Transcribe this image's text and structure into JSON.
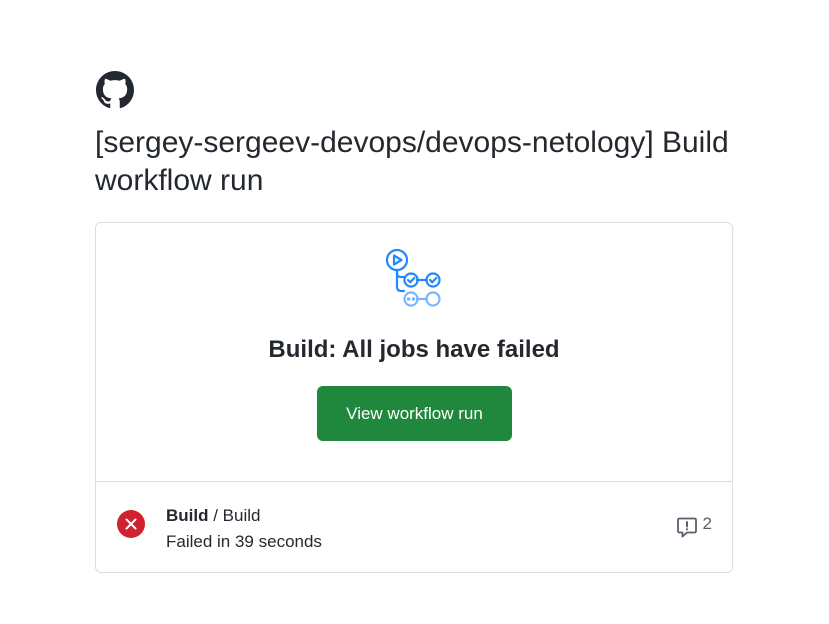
{
  "header": {
    "logo_icon": "github-mark-icon",
    "title": "[sergey-sergeev-devops/devops-netology] Build workflow run"
  },
  "card": {
    "icon": "workflow-icon",
    "headline": "Build: All jobs have failed",
    "button_label": "View workflow run",
    "button_color": "#1f883d"
  },
  "job": {
    "status_icon": "failure-x-icon",
    "status_color": "#cf222e",
    "workflow_name": "Build",
    "separator": " / ",
    "job_name": "Build",
    "status_text": "Failed in 39 seconds",
    "annotation_icon": "comment-alert-icon",
    "annotation_count": "2"
  }
}
